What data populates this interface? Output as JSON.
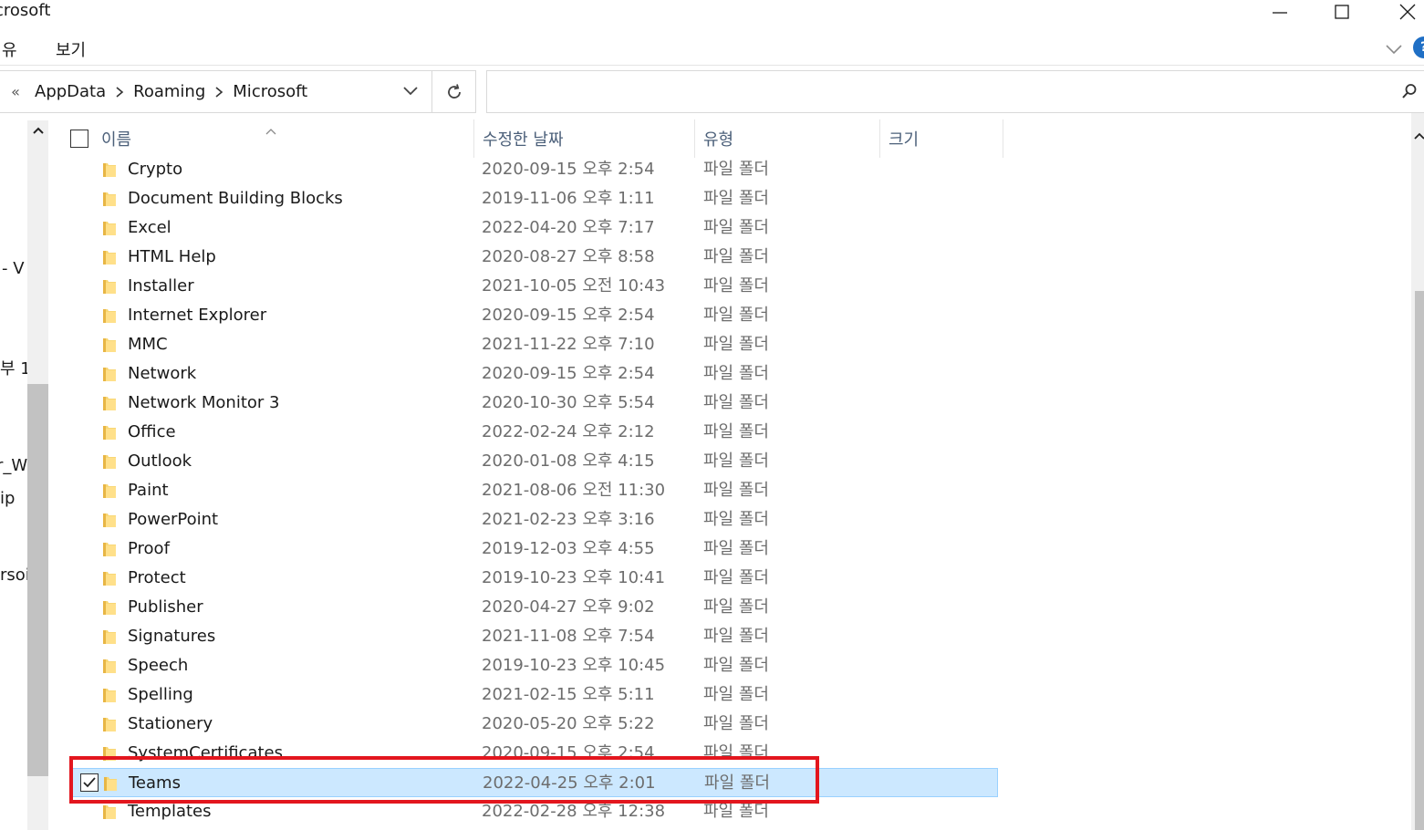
{
  "window": {
    "title": "crosoft",
    "controls": [
      "minimize-icon",
      "maximize-icon",
      "close-icon"
    ]
  },
  "ribbon": {
    "items": [
      {
        "label": "유"
      },
      {
        "label": "보기"
      }
    ],
    "help_label": "?"
  },
  "address": {
    "prev_label": "«",
    "crumbs": [
      "AppData",
      "Roaming",
      "Microsoft"
    ]
  },
  "search": {
    "placeholder": ""
  },
  "nav": {
    "fragments": [
      "- V",
      "부 1",
      "r_W",
      "ip",
      "rsoi"
    ]
  },
  "columns": [
    "이름",
    "수정한 날짜",
    "유형",
    "크기"
  ],
  "rows": [
    {
      "name": "Crypto",
      "date": "2020-09-15 오후 2:54",
      "type": "파일 폴더"
    },
    {
      "name": "Document Building Blocks",
      "date": "2019-11-06 오후 1:11",
      "type": "파일 폴더"
    },
    {
      "name": "Excel",
      "date": "2022-04-20 오후 7:17",
      "type": "파일 폴더"
    },
    {
      "name": "HTML Help",
      "date": "2020-08-27 오후 8:58",
      "type": "파일 폴더"
    },
    {
      "name": "Installer",
      "date": "2021-10-05 오전 10:43",
      "type": "파일 폴더"
    },
    {
      "name": "Internet Explorer",
      "date": "2020-09-15 오후 2:54",
      "type": "파일 폴더"
    },
    {
      "name": "MMC",
      "date": "2021-11-22 오후 7:10",
      "type": "파일 폴더"
    },
    {
      "name": "Network",
      "date": "2020-09-15 오후 2:54",
      "type": "파일 폴더"
    },
    {
      "name": "Network Monitor 3",
      "date": "2020-10-30 오후 5:54",
      "type": "파일 폴더"
    },
    {
      "name": "Office",
      "date": "2022-02-24 오후 2:12",
      "type": "파일 폴더"
    },
    {
      "name": "Outlook",
      "date": "2020-01-08 오후 4:15",
      "type": "파일 폴더"
    },
    {
      "name": "Paint",
      "date": "2021-08-06 오전 11:30",
      "type": "파일 폴더"
    },
    {
      "name": "PowerPoint",
      "date": "2021-02-23 오후 3:16",
      "type": "파일 폴더"
    },
    {
      "name": "Proof",
      "date": "2019-12-03 오후 4:55",
      "type": "파일 폴더"
    },
    {
      "name": "Protect",
      "date": "2019-10-23 오후 10:41",
      "type": "파일 폴더"
    },
    {
      "name": "Publisher",
      "date": "2020-04-27 오후 9:02",
      "type": "파일 폴더"
    },
    {
      "name": "Signatures",
      "date": "2021-11-08 오후 7:54",
      "type": "파일 폴더"
    },
    {
      "name": "Speech",
      "date": "2019-10-23 오후 10:45",
      "type": "파일 폴더"
    },
    {
      "name": "Spelling",
      "date": "2021-02-15 오후 5:11",
      "type": "파일 폴더"
    },
    {
      "name": "Stationery",
      "date": "2020-05-20 오후 5:22",
      "type": "파일 폴더"
    },
    {
      "name": "SystemCertificates",
      "date": "2020-09-15 오후 2:54",
      "type": "파일 폴더"
    },
    {
      "name": "Teams",
      "date": "2022-04-25 오후 2:01",
      "type": "파일 폴더",
      "selected": true,
      "checked": true
    },
    {
      "name": "Templates",
      "date": "2022-02-28 오후 12:38",
      "type": "파일 폴더"
    }
  ],
  "colors": {
    "selection": "#cce8ff",
    "highlight_box": "#e3161e",
    "folder": "#f8d775",
    "header_text": "#4c607a"
  }
}
